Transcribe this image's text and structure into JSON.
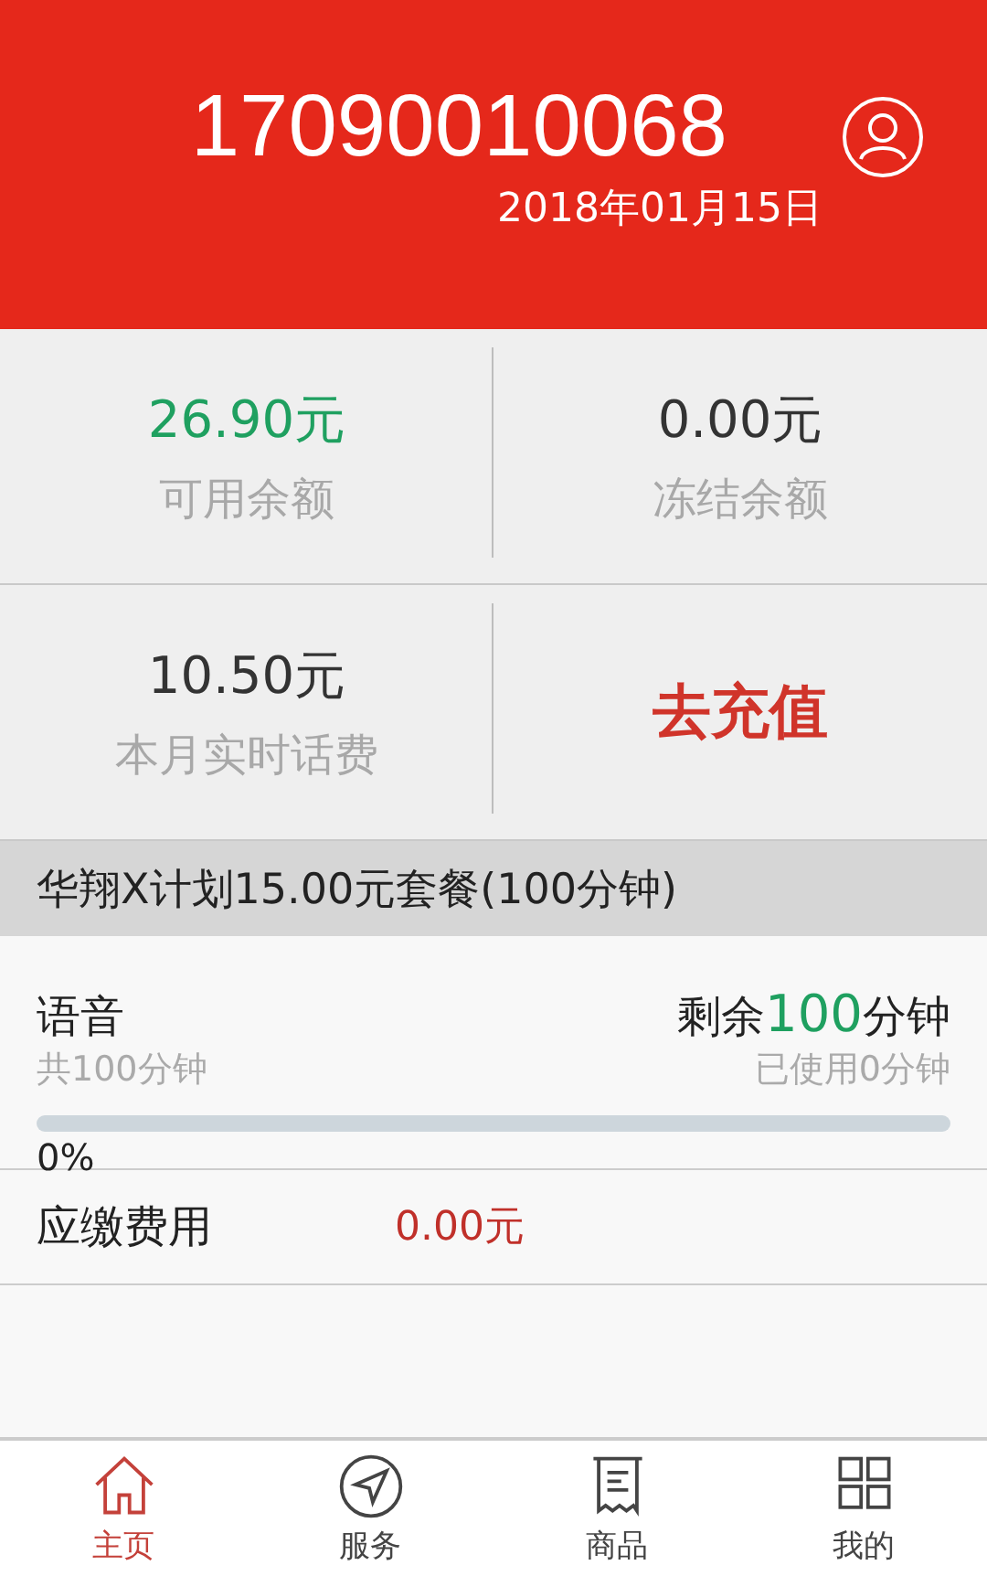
{
  "header": {
    "phone": "17090010068",
    "date": "2018年01月15日"
  },
  "balances": [
    {
      "amount": "26.90元",
      "label": "可用余额",
      "kind": "positive"
    },
    {
      "amount": "0.00元",
      "label": "冻结余额",
      "kind": "plain"
    },
    {
      "amount": "10.50元",
      "label": "本月实时话费",
      "kind": "plain"
    },
    {
      "action": "去充值",
      "kind": "action"
    }
  ],
  "plan": {
    "title": "华翔X计划15.00元套餐(100分钟)"
  },
  "usage": {
    "name": "语音",
    "total": "共100分钟",
    "remaining_prefix": "剩余",
    "remaining_value": "100",
    "remaining_suffix": "分钟",
    "used": "已使用0分钟",
    "level": 0,
    "percent": "0%"
  },
  "fee": {
    "label": "应缴费用",
    "amount": "0.00元"
  },
  "tabs": [
    {
      "label": "主页",
      "kind": "home",
      "selected": true
    },
    {
      "label": "服务",
      "kind": "send",
      "selected": false
    },
    {
      "label": "商品",
      "kind": "receipt",
      "selected": false
    },
    {
      "label": "我的",
      "kind": "grid",
      "selected": false
    }
  ]
}
